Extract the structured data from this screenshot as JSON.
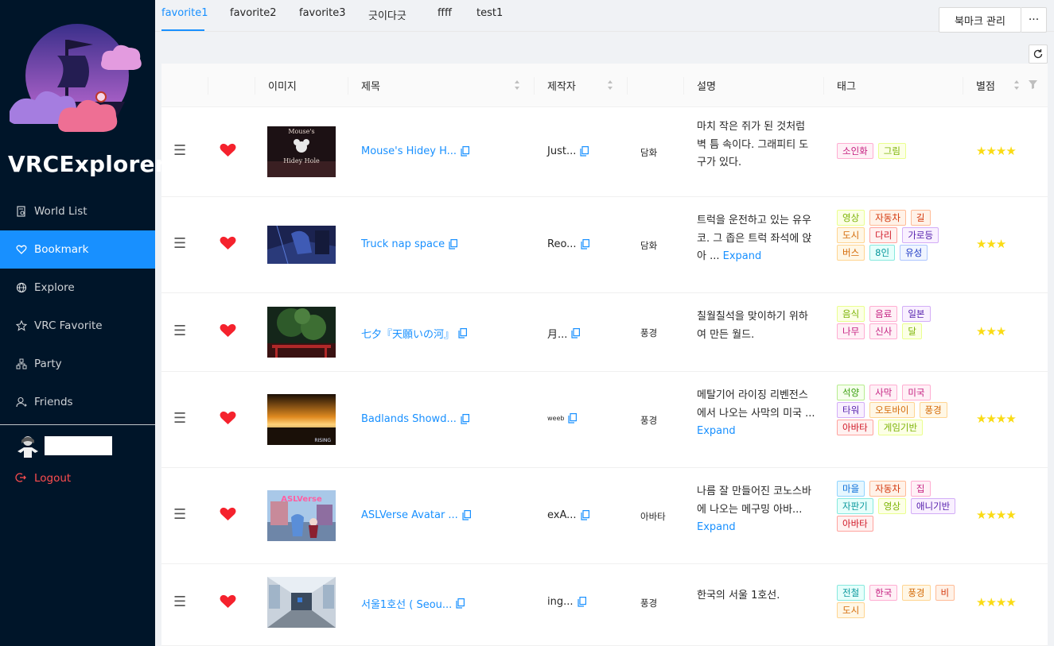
{
  "app": {
    "title": "VRCExplorer"
  },
  "sidebar": {
    "items": [
      {
        "label": "World List",
        "icon": "file-search-icon"
      },
      {
        "label": "Bookmark",
        "icon": "heart-icon",
        "active": true
      },
      {
        "label": "Explore",
        "icon": "globe-icon"
      },
      {
        "label": "VRC Favorite",
        "icon": "star-icon"
      },
      {
        "label": "Party",
        "icon": "cluster-icon"
      },
      {
        "label": "Friends",
        "icon": "user-switch-icon"
      }
    ],
    "logout": "Logout"
  },
  "tabs": [
    "favorite1",
    "favorite2",
    "favorite3",
    "긋이다긋",
    "ffff",
    "test1"
  ],
  "toolbar": {
    "manage_label": "북마크 관리",
    "more_label": "···"
  },
  "table": {
    "headers": {
      "image": "이미지",
      "title": "제목",
      "author": "제작자",
      "description": "설명",
      "tags": "태그",
      "rating": "별점"
    },
    "rows": [
      {
        "title": "Mouse's Hidey H...",
        "author": "Just...",
        "type": "담화",
        "desc": "마치 작은 쥐가 된 것처럼 벽 틈 속이다. 그래피티 도구가 있다.",
        "expand": "",
        "tags": [
          [
            "소인화",
            "magenta"
          ],
          [
            "그림",
            "lime"
          ]
        ],
        "stars": "★★★★",
        "thumb_text": "Mouse's Hidey Hole"
      },
      {
        "title": "Truck nap space",
        "author": "Reo...",
        "type": "담화",
        "desc": "트럭을 운전하고 있는 유우코. 그 좁은 트럭 좌석에 앉아 ...",
        "expand": "Expand",
        "tags": [
          [
            "영상",
            "lime"
          ],
          [
            "자동차",
            "volcano"
          ],
          [
            "길",
            "volcano"
          ],
          [
            "도시",
            "orange"
          ],
          [
            "다리",
            "red"
          ],
          [
            "가로등",
            "purple"
          ],
          [
            "버스",
            "orange"
          ],
          [
            "8인",
            "cyan"
          ],
          [
            "유성",
            "geekblue"
          ]
        ],
        "stars": "★★★",
        "thumb_text": ""
      },
      {
        "title": "七夕『天願いの河』",
        "author": "月...",
        "type": "풍경",
        "desc": "칠월칠석을 맞이하기 위하여 만든 월드.",
        "expand": "",
        "tags": [
          [
            "음식",
            "lime"
          ],
          [
            "음료",
            "magenta"
          ],
          [
            "일본",
            "purple"
          ],
          [
            "나무",
            "magenta"
          ],
          [
            "신사",
            "magenta"
          ],
          [
            "달",
            "lime"
          ]
        ],
        "stars": "★★★",
        "thumb_text": ""
      },
      {
        "title": "Badlands Showd...",
        "author": "weeb",
        "type": "풍경",
        "desc": "메탈기어 라이징 리벤전스에서 나오는 사막의 미국 ...",
        "expand": "Expand",
        "tags": [
          [
            "석양",
            "green"
          ],
          [
            "사막",
            "magenta"
          ],
          [
            "미국",
            "magenta"
          ],
          [
            "타워",
            "purple"
          ],
          [
            "오토바이",
            "orange"
          ],
          [
            "풍경",
            "orange"
          ],
          [
            "아바타",
            "red"
          ],
          [
            "게임기반",
            "lime"
          ]
        ],
        "stars": "★★★★",
        "thumb_text": "RISING"
      },
      {
        "title": "ASLVerse Avatar ...",
        "author": "exA...",
        "type": "아바타",
        "desc": "나름 잘 만들어진 코노스바에 나오는 메구밍 아바...",
        "expand": "Expand",
        "tags": [
          [
            "마을",
            "blue"
          ],
          [
            "자동차",
            "volcano"
          ],
          [
            "집",
            "magenta"
          ],
          [
            "자판기",
            "cyan"
          ],
          [
            "영상",
            "lime"
          ],
          [
            "애니기반",
            "purple"
          ],
          [
            "아바타",
            "red"
          ]
        ],
        "stars": "★★★★",
        "thumb_text": "ASLVerse"
      },
      {
        "title": "서울1호선 ( Seou...",
        "author": "ing...",
        "type": "풍경",
        "desc": "한국의 서울 1호선.",
        "expand": "",
        "tags": [
          [
            "전철",
            "cyan"
          ],
          [
            "한국",
            "magenta"
          ],
          [
            "풍경",
            "orange"
          ],
          [
            "비",
            "volcano"
          ],
          [
            "도시",
            "orange"
          ]
        ],
        "stars": "★★★★",
        "thumb_text": ""
      }
    ]
  },
  "colors": {
    "sidebar_bg": "#001529",
    "accent": "#1890ff",
    "heart": "#f5222d",
    "star": "#fadb14",
    "logout": "#ff4d4f"
  }
}
